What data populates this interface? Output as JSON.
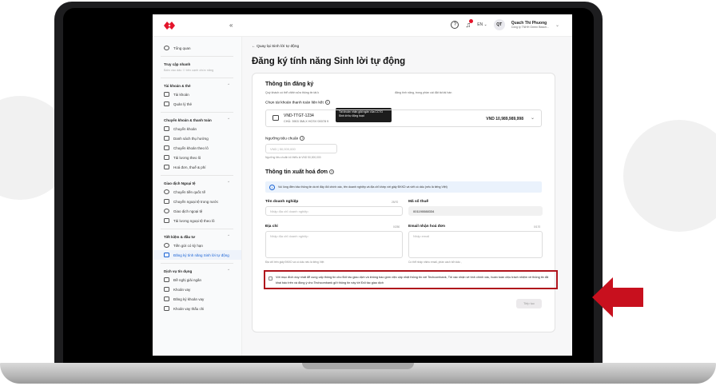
{
  "colors": {
    "brand_red": "#e4142a",
    "highlight_red": "#b0141c",
    "arrow_red": "#c8101e",
    "active_blue": "#1862d4"
  },
  "topbar": {
    "collapse": "«",
    "language": "EN ⌄",
    "avatar_initials": "QT",
    "user_name": "Quach Thi Phuong",
    "user_company": "Công ty TNHH Green Beach..."
  },
  "sidebar": {
    "overview": "Tổng quan",
    "quick_access": {
      "title": "Truy cập nhanh",
      "hint": "Bấm vào dấu ✩ bên cạnh chức năng"
    },
    "accounts": {
      "title": "Tài khoản & thẻ",
      "items": [
        "Tài khoản",
        "Quản lý thẻ"
      ]
    },
    "transfer": {
      "title": "Chuyển khoản & thanh toán",
      "items": [
        "Chuyển khoản",
        "Danh sách thụ hưởng",
        "Chuyển khoản theo lô",
        "Tải lương theo lô",
        "Hoá đơn, thuế & phí"
      ]
    },
    "fx": {
      "title": "Giao dịch Ngoại tệ",
      "items": [
        "Chuyển tiền quốc tế",
        "Chuyển ngoại tệ trong nước",
        "Giao dịch ngoại tệ",
        "Tải lương ngoại tệ theo lô"
      ]
    },
    "savings": {
      "title": "Tiết kiệm & đầu tư",
      "items": [
        "Tiền gửi có kỳ hạn",
        "Đăng ký tính năng Sinh lời tự động"
      ]
    },
    "credit": {
      "title": "Dịch vụ tín dụng",
      "items": [
        "Đề nghị giải ngân",
        "Khoản vay",
        "Đăng ký khoản vay",
        "Khoản vay thấu chi"
      ]
    }
  },
  "page": {
    "back": "Quay lại Sinh lời tự động",
    "title": "Đăng ký tính năng Sinh lời tự động"
  },
  "reg_info": {
    "title": "Thông tin đăng ký",
    "desc_start": "Quý khách có thể chỉnh sửa thông tin tài k",
    "desc_end": "đăng tính năng, trong phần cài đặt tài tài hàn",
    "tooltip": "Tài khoản nhận giải ngân của CCTG Sinh lời tự động hoạt",
    "account_label": "Chọn tài khoản thanh toán liên kết",
    "account_name": "VND-TTGT-1234",
    "account_number": "CHỦ: 3903 3MLX HCSV 00078 9",
    "account_balance": "VND 10,989,989,998",
    "threshold_label": "Ngưỡng tiêu chuẩn",
    "threshold_placeholder": "VND | 50,000,000",
    "threshold_hint": "Ngưỡng tiêu chuẩn tối thiểu là VND 50,000,000"
  },
  "invoice": {
    "title": "Thông tin xuất hoá đơn",
    "notice": "Vui lòng điền bảo thông tin dưới đây đối chính xác, tên doanh nghiệp và địa chỉ khớp với giấy ĐKKD và viết có dấu (nếu là tiếng Việt)",
    "company_label": "Tên doanh nghiệp",
    "company_count": "25/70",
    "company_placeholder": "Nhập địa chỉ doanh nghiệp",
    "tax_label": "Mã số thuế",
    "tax_value": "001190088334",
    "address_label": "Địa chỉ",
    "address_count": "0/250",
    "address_placeholder": "Nhập địa chỉ doanh nghiệp",
    "address_hint": "Địa chỉ trên giấy ĐKKD và có dấu nếu là tiếng Việt",
    "email_label": "Email nhận hoá đơn",
    "email_count": "0/170",
    "email_placeholder": "Nhập email",
    "email_hint": "Có thể nhập nhiều email, phân cách bởi dấu ,"
  },
  "consent": "Với mục đích duy nhất để cung cấp thông tin cho Đối tác giao dịch và không bao gồm việc cập nhật thông tin với Techcombank, Tôi xác nhận về tính chính xác, hoàn toàn chịu trách nhiệm về thông tin đã khai báo trên và đồng ý cho Techcombank gửi thông tin này tới Đối tác giao dịch",
  "next_button": "Tiếp tục"
}
